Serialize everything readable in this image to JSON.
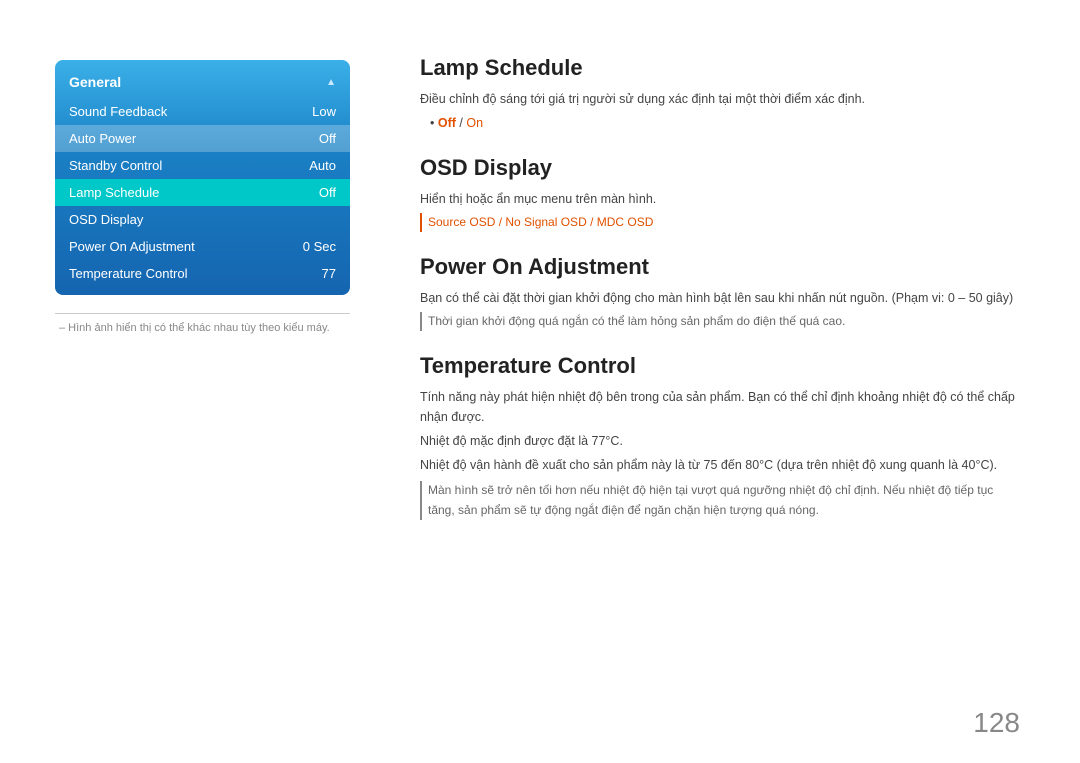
{
  "menu": {
    "header": "General",
    "items": [
      {
        "label": "Sound Feedback",
        "value": "Low",
        "state": "normal"
      },
      {
        "label": "Auto Power",
        "value": "Off",
        "state": "active-blue"
      },
      {
        "label": "Standby Control",
        "value": "Auto",
        "state": "normal"
      },
      {
        "label": "Lamp Schedule",
        "value": "Off",
        "state": "active-cyan"
      },
      {
        "label": "OSD Display",
        "value": "",
        "state": "normal"
      },
      {
        "label": "Power On Adjustment",
        "value": "0 Sec",
        "state": "normal"
      },
      {
        "label": "Temperature Control",
        "value": "77",
        "state": "normal"
      }
    ],
    "footnote": "– Hình ảnh hiển thị có thể khác nhau tùy theo kiểu máy."
  },
  "sections": [
    {
      "id": "lamp-schedule",
      "title": "Lamp Schedule",
      "body": "Điều chỉnh độ sáng tới giá trị người sử dụng xác định tại một thời điểm xác định.",
      "bullets": [
        "Off / On"
      ],
      "bullets_highlight": [
        true
      ],
      "dash_note": null,
      "dash_note_gray": null
    },
    {
      "id": "osd-display",
      "title": "OSD Display",
      "body": "Hiển thị hoặc ẩn mục menu trên màn hình.",
      "bullets": null,
      "dash_note": "Source OSD / No Signal OSD / MDC OSD",
      "dash_note_gray": null
    },
    {
      "id": "power-on-adjustment",
      "title": "Power On Adjustment",
      "body": "Bạn có thể cài đặt thời gian khởi động cho màn hình bật lên sau khi nhấn nút nguồn. (Phạm vi: 0 – 50 giây)",
      "bullets": null,
      "dash_note": null,
      "dash_note_gray": "Thời gian khởi động quá ngắn có thể làm hỏng sản phẩm do điện thế quá cao."
    },
    {
      "id": "temperature-control",
      "title": "Temperature Control",
      "body1": "Tính năng này phát hiện nhiệt độ bên trong của sản phẩm. Bạn có thể chỉ định khoảng nhiệt độ có thể chấp nhận được.",
      "body2": "Nhiệt độ mặc định được đặt là 77°C.",
      "body3": "Nhiệt độ vận hành đề xuất cho sản phẩm này là từ 75 đến 80°C (dựa trên nhiệt độ xung quanh là 40°C).",
      "dash_note_gray": "Màn hình sẽ trở nên tối hơn nếu nhiệt độ hiện tại vượt quá ngưỡng nhiệt độ chỉ định. Nếu nhiệt độ tiếp tục tăng, sản phẩm sẽ tự động ngắt điện để ngăn chặn hiện tượng quá nóng."
    }
  ],
  "page_number": "128"
}
